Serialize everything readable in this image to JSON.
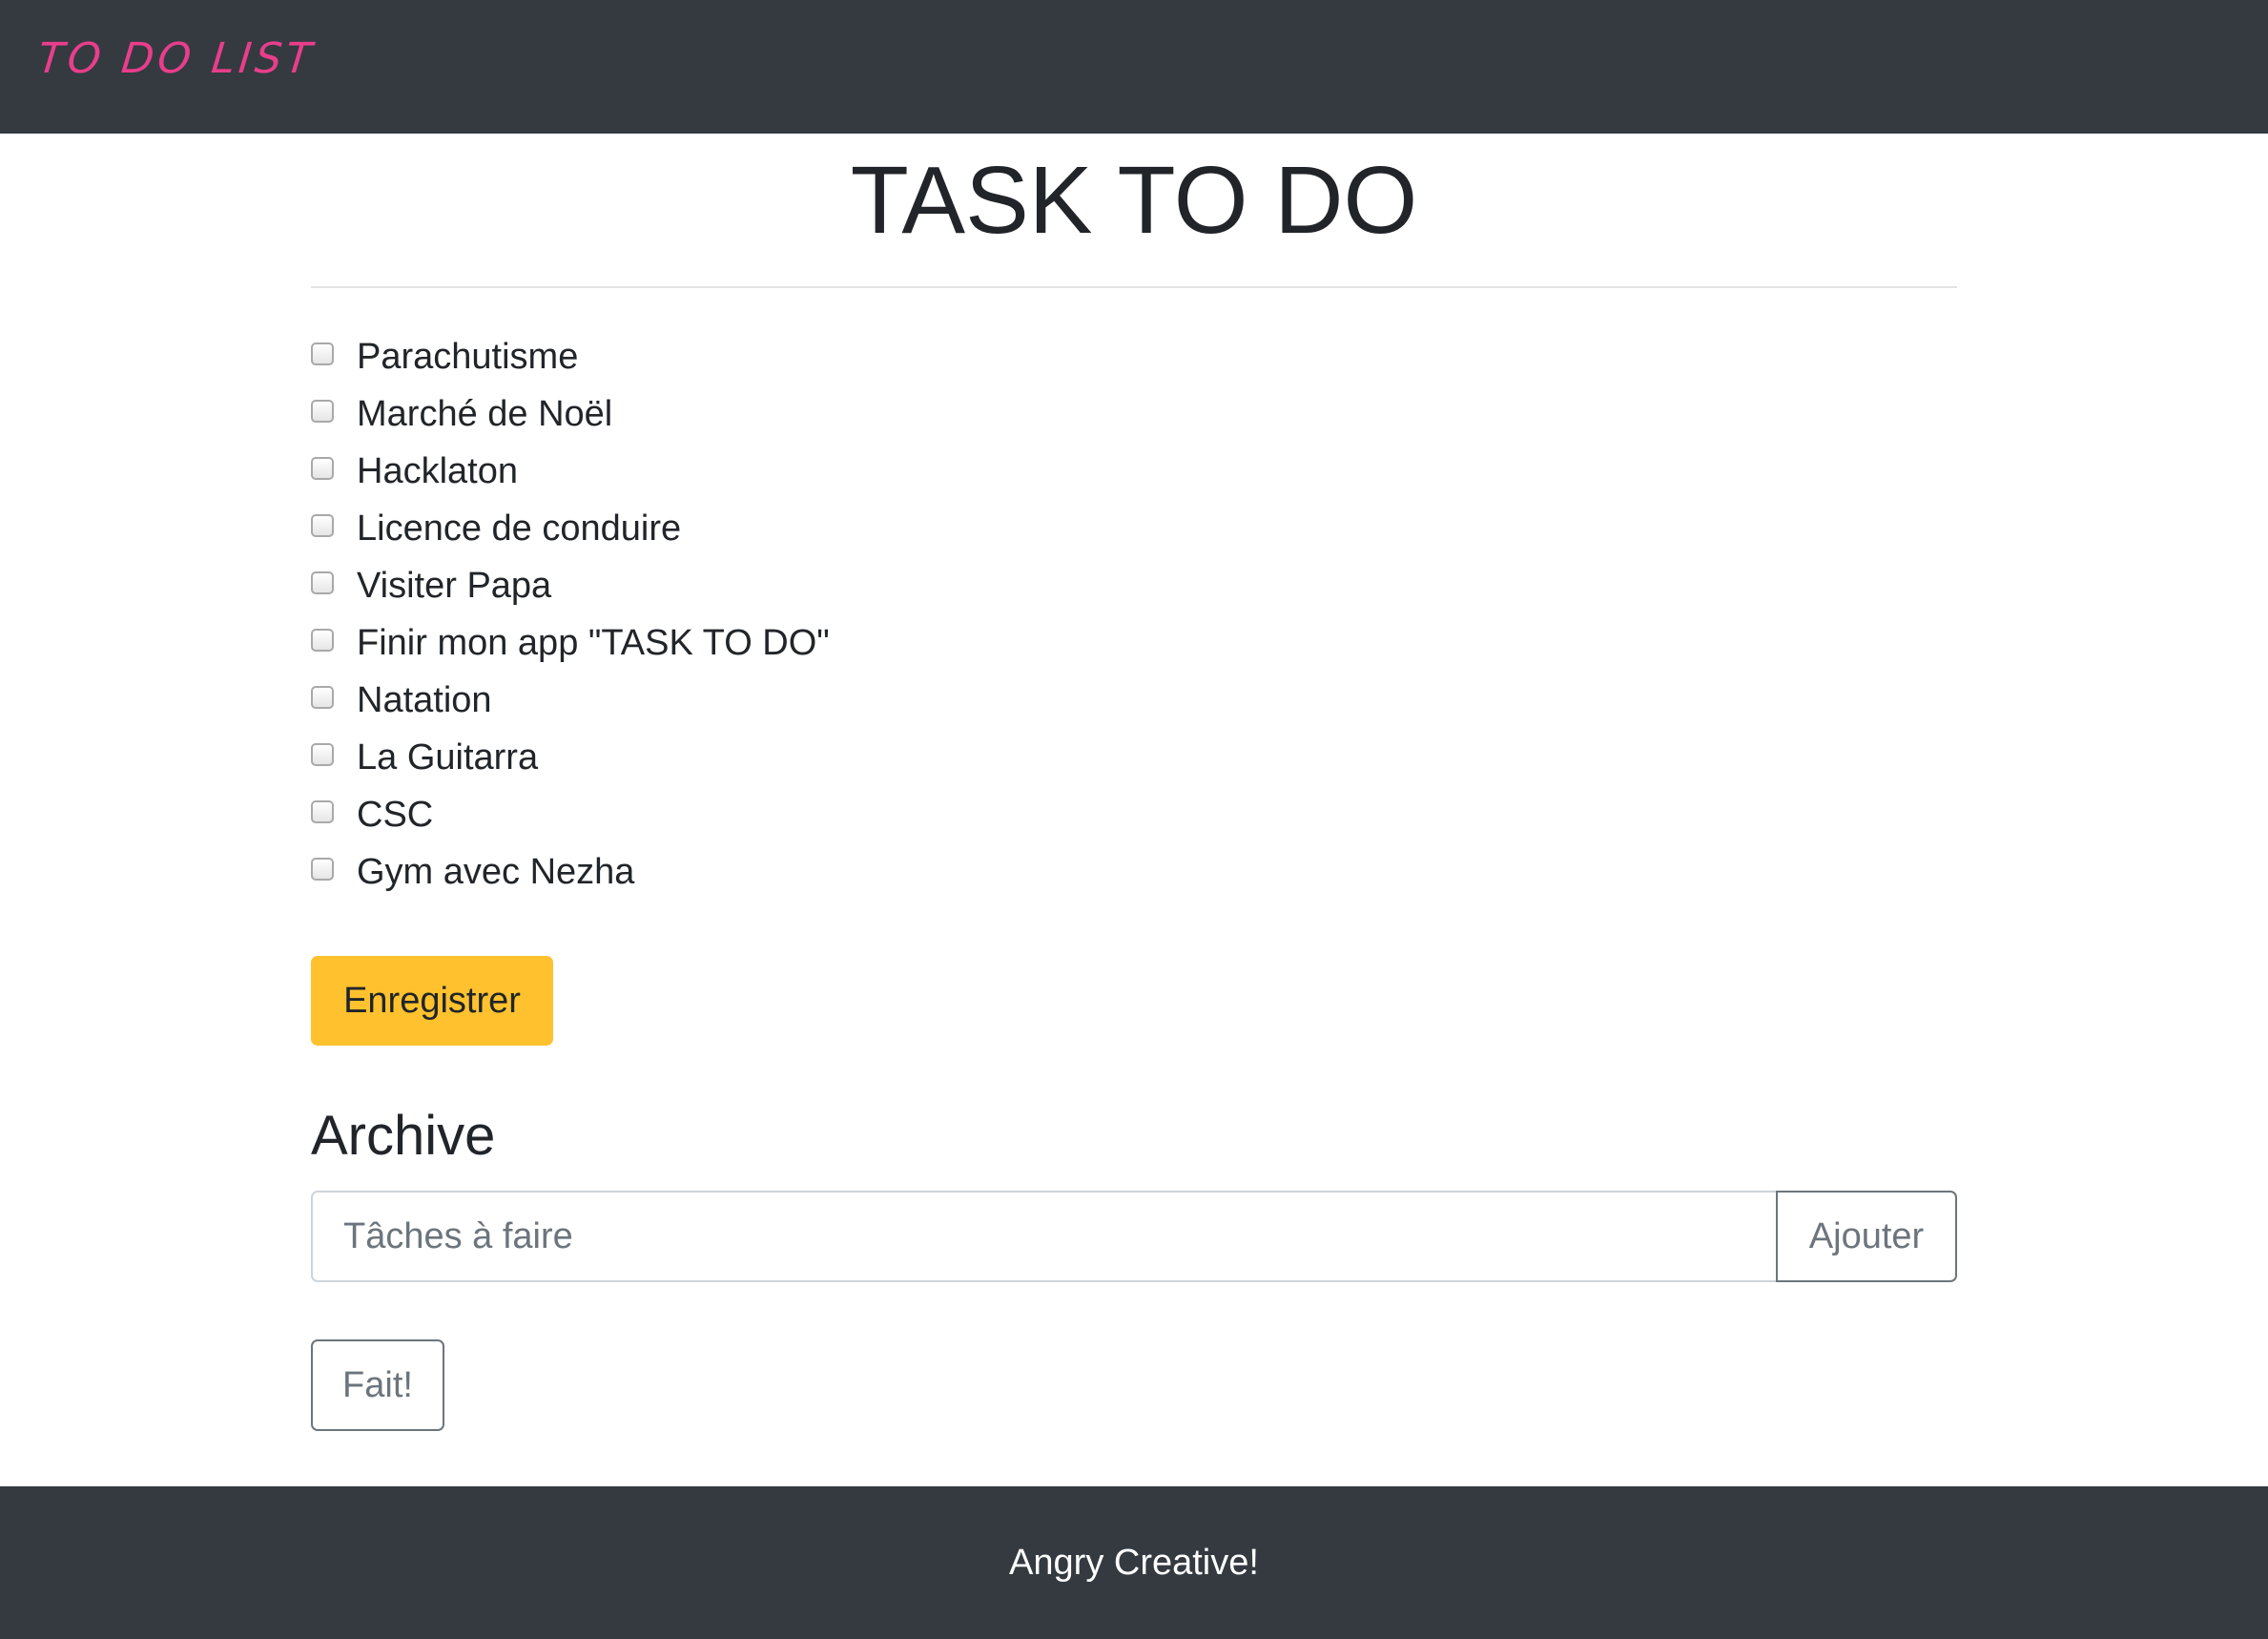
{
  "navbar": {
    "brand": "TO DO LIST",
    "brand_color": "#e83e8c",
    "background": "#343a40"
  },
  "main": {
    "title": "TASK TO DO",
    "tasks": [
      {
        "label": "Parachutisme",
        "checked": false
      },
      {
        "label": "Marché de Noël",
        "checked": false
      },
      {
        "label": "Hacklaton",
        "checked": false
      },
      {
        "label": "Licence de conduire",
        "checked": false
      },
      {
        "label": "Visiter Papa",
        "checked": false
      },
      {
        "label": "Finir mon app \"TASK TO DO\"",
        "checked": false
      },
      {
        "label": "Natation",
        "checked": false
      },
      {
        "label": "La Guitarra",
        "checked": false
      },
      {
        "label": "CSC",
        "checked": false
      },
      {
        "label": "Gym avec Nezha",
        "checked": false
      }
    ],
    "save_button": "Enregistrer",
    "save_button_color": "#ffc22e",
    "archive_title": "Archive",
    "task_input": {
      "placeholder": "Tâches à faire",
      "value": ""
    },
    "add_button": "Ajouter",
    "done_button": "Fait!"
  },
  "footer": {
    "text": "Angry Creative!"
  }
}
